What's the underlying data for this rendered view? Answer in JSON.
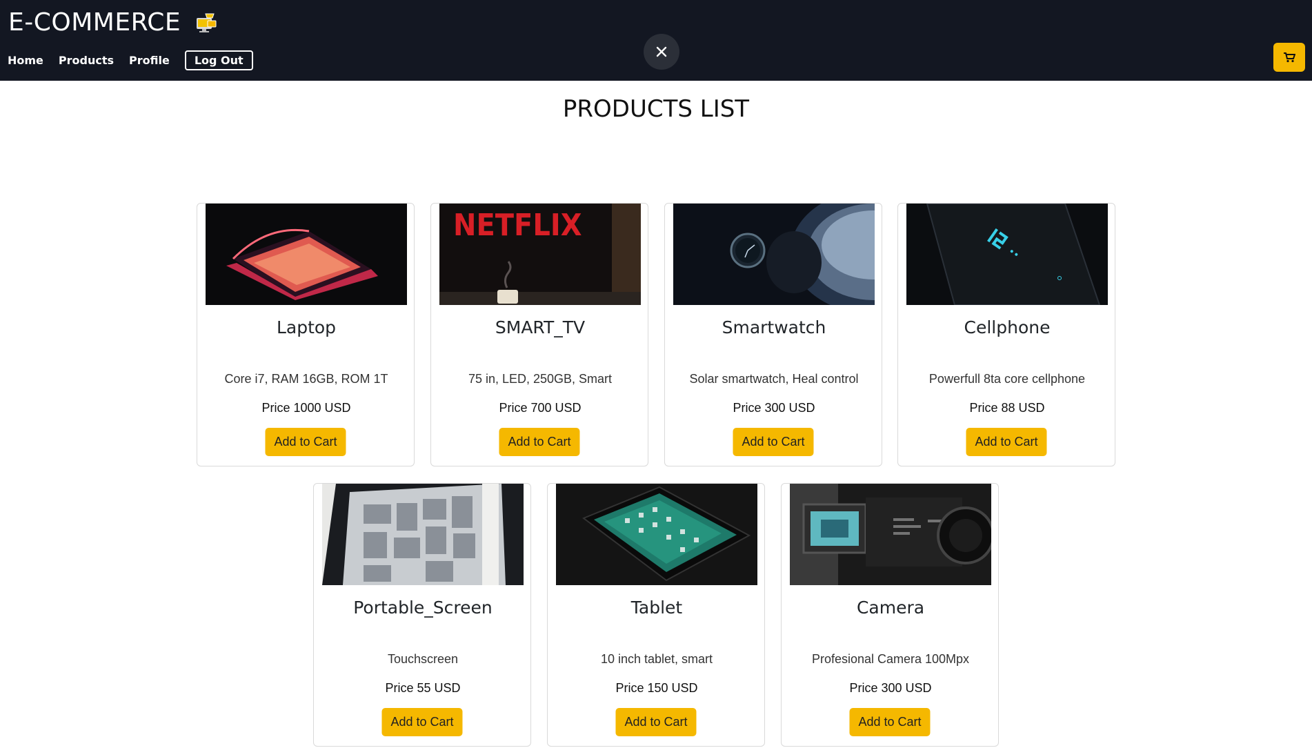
{
  "header": {
    "brand": "E-COMMERCE",
    "brand_icon": "shop-computer-icon",
    "nav": {
      "home": "Home",
      "products": "Products",
      "profile": "Profile",
      "logout": "Log Out"
    },
    "close_icon": "close-icon",
    "cart_icon": "cart-icon",
    "accent_color": "#f5b800",
    "bg_color": "#131722"
  },
  "main": {
    "title": "PRODUCTS LIST",
    "products": [
      {
        "name": "Laptop",
        "description": "Core i7, RAM 16GB, ROM 1T",
        "price": "Price 1000 USD",
        "button": "Add to Cart"
      },
      {
        "name": "SMART_TV",
        "description": "75 in, LED, 250GB, Smart",
        "price": "Price 700 USD",
        "button": "Add to Cart",
        "image_text": "NETFLIX"
      },
      {
        "name": "Smartwatch",
        "description": "Solar smartwatch, Heal control",
        "price": "Price 300 USD",
        "button": "Add to Cart"
      },
      {
        "name": "Cellphone",
        "description": "Powerfull 8ta core cellphone",
        "price": "Price 88 USD",
        "button": "Add to Cart"
      },
      {
        "name": "Portable_Screen",
        "description": "Touchscreen",
        "price": "Price 55 USD",
        "button": "Add to Cart"
      },
      {
        "name": "Tablet",
        "description": "10 inch tablet, smart",
        "price": "Price 150 USD",
        "button": "Add to Cart"
      },
      {
        "name": "Camera",
        "description": "Profesional Camera 100Mpx",
        "price": "Price 300 USD",
        "button": "Add to Cart"
      }
    ]
  }
}
